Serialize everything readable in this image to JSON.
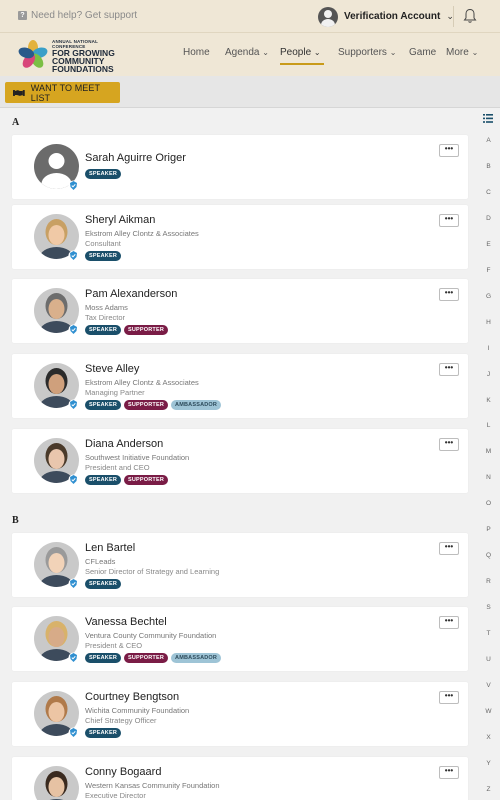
{
  "topbar": {
    "help_text": "Need help? Get support",
    "account_label": "Verification Account"
  },
  "nav": {
    "logo_small": "ANNUAL NATIONAL CONFERENCE",
    "logo_lines": [
      "FOR GROWING",
      "COMMUNITY",
      "FOUNDATIONS"
    ],
    "items": [
      {
        "label": "Home"
      },
      {
        "label": "Agenda",
        "dropdown": true
      },
      {
        "label": "People",
        "dropdown": true,
        "active": true
      },
      {
        "label": "Supporters",
        "dropdown": true
      },
      {
        "label": "Game"
      },
      {
        "label": "More",
        "dropdown": true
      }
    ],
    "accent_color": "#c99b1a"
  },
  "toolbar": {
    "meet_button_label": "WANT TO MEET LIST"
  },
  "sections": [
    {
      "letter": "A",
      "people": [
        {
          "name": "Sarah Aguirre Origer",
          "org": "",
          "title": "",
          "badges": [
            "SPEAKER"
          ],
          "placeholder": true
        },
        {
          "name": "Sheryl Aikman",
          "org": "Ekstrom Alley Clontz & Associates",
          "title": "Consultant",
          "badges": [
            "SPEAKER"
          ]
        },
        {
          "name": "Pam Alexanderson",
          "org": "Moss Adams",
          "title": "Tax Director",
          "badges": [
            "SPEAKER",
            "SUPPORTER"
          ]
        },
        {
          "name": "Steve Alley",
          "org": "Ekstrom Alley Clontz & Associates",
          "title": "Managing Partner",
          "badges": [
            "SPEAKER",
            "SUPPORTER",
            "AMBASSADOR"
          ]
        },
        {
          "name": "Diana Anderson",
          "org": "Southwest Initiative Foundation",
          "title": "President and CEO",
          "badges": [
            "SPEAKER",
            "SUPPORTER"
          ]
        }
      ]
    },
    {
      "letter": "B",
      "people": [
        {
          "name": "Len Bartel",
          "org": "CFLeads",
          "title": "Senior Director of Strategy and Learning",
          "badges": [
            "SPEAKER"
          ]
        },
        {
          "name": "Vanessa Bechtel",
          "org": "Ventura County Community Foundation",
          "title": "President & CEO",
          "badges": [
            "SPEAKER",
            "SUPPORTER",
            "AMBASSADOR"
          ]
        },
        {
          "name": "Courtney Bengtson",
          "org": "Wichita Community Foundation",
          "title": "Chief Strategy Officer",
          "badges": [
            "SPEAKER"
          ]
        },
        {
          "name": "Conny Bogaard",
          "org": "Western Kansas Community Foundation",
          "title": "Executive Director",
          "badges": []
        }
      ]
    }
  ],
  "more_button_label": "•••",
  "alphabet": [
    "A",
    "B",
    "C",
    "D",
    "E",
    "F",
    "G",
    "H",
    "I",
    "J",
    "K",
    "L",
    "M",
    "N",
    "O",
    "P",
    "Q",
    "R",
    "S",
    "T",
    "U",
    "V",
    "W",
    "X",
    "Y",
    "Z"
  ],
  "badge_colors": {
    "SPEAKER": "#1a4f6a",
    "SUPPORTER": "#7a1c46",
    "AMBASSADOR": "#9ec4d6"
  }
}
